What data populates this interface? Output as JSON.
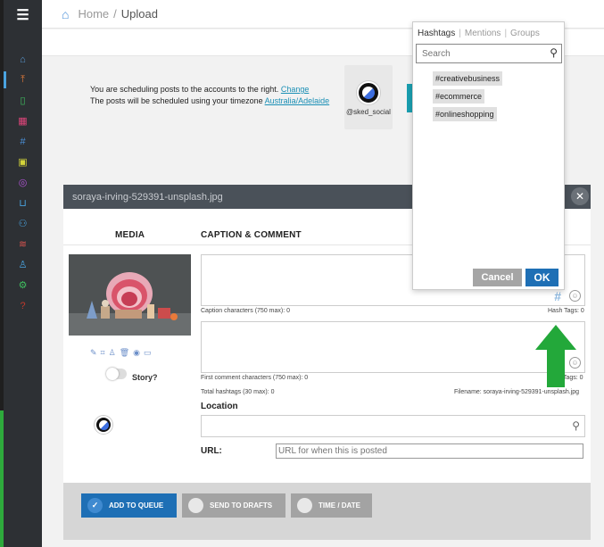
{
  "breadcrumb": {
    "home": "Home",
    "separator": "/",
    "current": "Upload"
  },
  "notice": {
    "line1": "You are scheduling posts to the accounts to the right.",
    "change_link": "Change",
    "line2": "The posts will be scheduled using your timezone",
    "timezone_link": "Australia/Adelaide"
  },
  "account": {
    "handle": "@sked_social"
  },
  "post": {
    "filename_title": "soraya-irving-529391-unsplash.jpg",
    "media_header": "MEDIA",
    "caption_header": "CAPTION & COMMENT",
    "story_label": "Story?",
    "caption_count": "Caption characters (750 max): 0",
    "caption_hashtags": "Hash Tags: 0",
    "comment_count": "First comment characters (750 max): 0",
    "comment_hashtags": "Tags: 0",
    "total_hashtags": "Total hashtags (30 max): 0",
    "filename_label": "Filename: soraya-irving-529391-unsplash.jpg",
    "location_label": "Location",
    "url_label": "URL:",
    "url_placeholder": "URL for when this is posted"
  },
  "footer": {
    "add_queue": "ADD TO QUEUE",
    "send_drafts": "SEND TO DRAFTS",
    "time_date": "TIME / DATE"
  },
  "popup": {
    "tabs": [
      "Hashtags",
      "Mentions",
      "Groups"
    ],
    "search_placeholder": "Search",
    "hashtags": [
      "#creativebusiness",
      "#ecommerce",
      "#onlineshopping"
    ],
    "cancel": "Cancel",
    "ok": "OK"
  },
  "colors": {
    "sidebar": "#2d3034",
    "primary": "#1e6fb5",
    "arrow": "#23a83a",
    "header_bar": "#4a5159"
  },
  "sidebar_icons": [
    "home-icon",
    "upload-icon",
    "phone-icon",
    "calendar-icon",
    "hashtag-icon",
    "report-icon",
    "instagram-icon",
    "inbox-icon",
    "users-icon",
    "layers-icon",
    "profile-icon",
    "settings-icon",
    "help-icon"
  ]
}
